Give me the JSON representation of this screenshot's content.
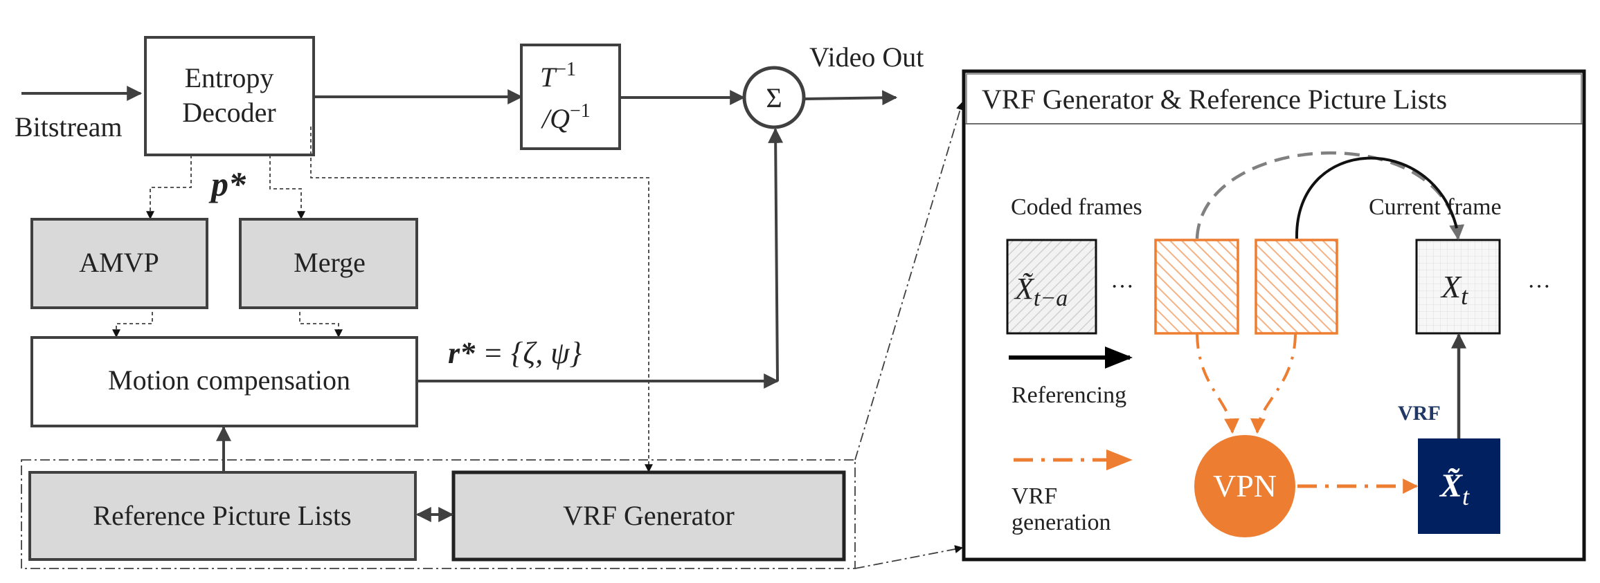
{
  "colors": {
    "line": "#404040",
    "block_fill": "#d9d9d9",
    "orange": "#ed7d31",
    "navy": "#002060",
    "vrf_label": "#203864",
    "gray_dash": "#808080"
  },
  "decoder": {
    "input_label": "Bitstream",
    "entropy_line1": "Entropy",
    "entropy_line2": "Decoder",
    "tq_line1_base": "T",
    "tq_line1_sup": "−1",
    "tq_line2_base": "/Q",
    "tq_line2_sup": "−1",
    "sum_symbol": "Σ",
    "output_label": "Video Out",
    "p_star": "p*",
    "amvp": "AMVP",
    "merge": "Merge",
    "motion_compensation": "Motion compensation",
    "r_star_lhs": "r*",
    "r_star_rhs": " = {ζ, ψ}",
    "reference_picture_lists": "Reference Picture Lists",
    "vrf_generator": "VRF Generator"
  },
  "detail": {
    "title": "VRF Generator & Reference Picture Lists",
    "coded_frames": "Coded frames",
    "current_frame": "Current frame",
    "frame_old_base": "X̃",
    "frame_old_sub": "t−a",
    "frame_current_base": "X",
    "frame_current_sub": "t",
    "vrf_frame_base": "X̃",
    "vrf_frame_sub": "t",
    "ellipsis_left": "···",
    "ellipsis_right": "···",
    "legend_referencing": "Referencing",
    "legend_vrf_line1": "VRF",
    "legend_vrf_line2": "generation",
    "vpn": "VPN",
    "vrf_label": "VRF"
  }
}
